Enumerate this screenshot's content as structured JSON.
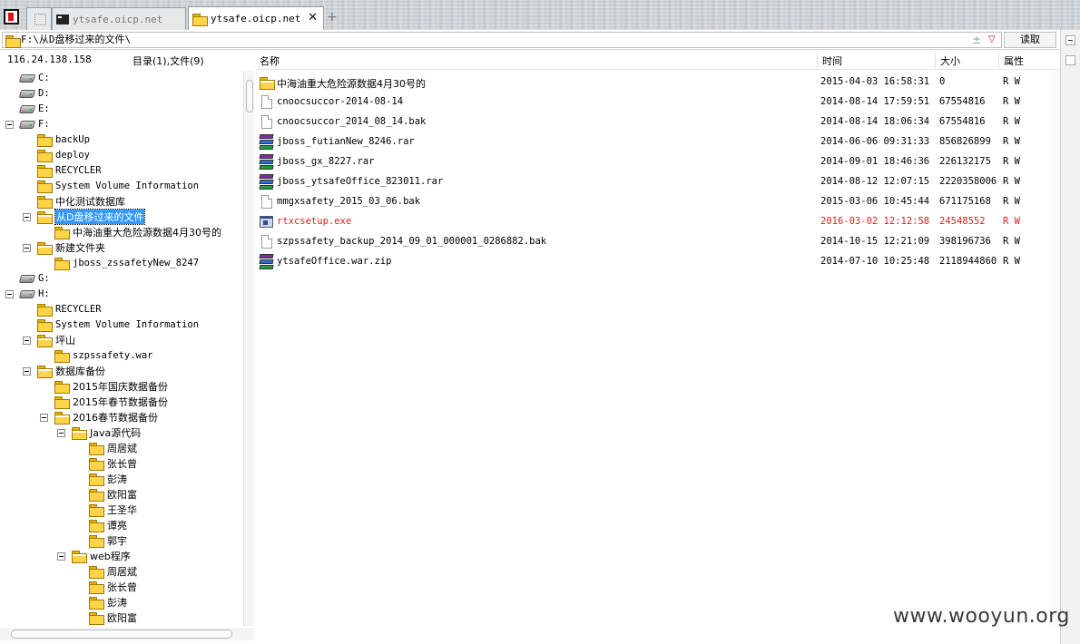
{
  "tabs": [
    {
      "label": "ytsafe.oicp.net"
    },
    {
      "label": "ytsafe.oicp.net",
      "active": true
    }
  ],
  "address": {
    "path": "F:\\从D盘移过来的文件\\",
    "read_label": "读取"
  },
  "tree_panel": {
    "ip": "116.24.138.158",
    "summary": "目录(1),文件(9)",
    "nodes": [
      {
        "label": "C:",
        "type": "drive"
      },
      {
        "label": "D:",
        "type": "drive"
      },
      {
        "label": "E:",
        "type": "drive"
      },
      {
        "label": "F:",
        "type": "drive",
        "expanded": true
      },
      {
        "label": "backUp",
        "type": "folder"
      },
      {
        "label": "deploy",
        "type": "folder"
      },
      {
        "label": "RECYCLER",
        "type": "folder"
      },
      {
        "label": "System Volume Information",
        "type": "folder"
      },
      {
        "label": "中化测试数据库",
        "type": "folder"
      },
      {
        "label": "从D盘移过来的文件",
        "type": "folder",
        "expanded": true,
        "selected": true
      },
      {
        "label": "中海油重大危险源数据4月30号的",
        "type": "folder"
      },
      {
        "label": "新建文件夹",
        "type": "folder",
        "expanded": true
      },
      {
        "label": "jboss_zssafetyNew_8247",
        "type": "folder"
      },
      {
        "label": "G:",
        "type": "drive"
      },
      {
        "label": "H:",
        "type": "drive",
        "expanded": true
      },
      {
        "label": "RECYCLER",
        "type": "folder"
      },
      {
        "label": "System Volume Information",
        "type": "folder"
      },
      {
        "label": "坪山",
        "type": "folder",
        "expanded": true
      },
      {
        "label": "szpssafety.war",
        "type": "folder"
      },
      {
        "label": "数据库备份",
        "type": "folder",
        "expanded": true
      },
      {
        "label": "2015年国庆数据备份",
        "type": "folder"
      },
      {
        "label": "2015年春节数据备份",
        "type": "folder"
      },
      {
        "label": "2016春节数据备份",
        "type": "folder",
        "expanded": true
      },
      {
        "label": "Java源代码",
        "type": "folder",
        "expanded": true
      },
      {
        "label": "周居斌",
        "type": "folder"
      },
      {
        "label": "张长曾",
        "type": "folder"
      },
      {
        "label": "彭涛",
        "type": "folder"
      },
      {
        "label": "欧阳富",
        "type": "folder"
      },
      {
        "label": "王圣华",
        "type": "folder"
      },
      {
        "label": "谭亮",
        "type": "folder"
      },
      {
        "label": "郭宇",
        "type": "folder"
      },
      {
        "label": "web程序",
        "type": "folder",
        "expanded": true
      },
      {
        "label": "周居斌",
        "type": "folder"
      },
      {
        "label": "张长曾",
        "type": "folder"
      },
      {
        "label": "彭涛",
        "type": "folder"
      },
      {
        "label": "欧阳富",
        "type": "folder"
      }
    ]
  },
  "file_list": {
    "columns": {
      "name": "名称",
      "time": "时间",
      "size": "大小",
      "attr": "属性"
    },
    "rows": [
      {
        "name": "中海油重大危险源数据4月30号的",
        "time": "2015-04-03 16:58:31",
        "size": "0",
        "attr": "R W",
        "icon": "folder-icon"
      },
      {
        "name": "cnoocsuccor-2014-08-14",
        "time": "2014-08-14 17:59:51",
        "size": "67554816",
        "attr": "R W",
        "icon": "file-icon"
      },
      {
        "name": "cnoocsuccor_2014_08_14.bak",
        "time": "2014-08-14 18:06:34",
        "size": "67554816",
        "attr": "R W",
        "icon": "file-icon"
      },
      {
        "name": "jboss_futianNew_8246.rar",
        "time": "2014-06-06 09:31:33",
        "size": "856826899",
        "attr": "R W",
        "icon": "archive-icon"
      },
      {
        "name": "jboss_gx_8227.rar",
        "time": "2014-09-01 18:46:36",
        "size": "226132175",
        "attr": "R W",
        "icon": "archive-icon"
      },
      {
        "name": "jboss_ytsafeOffice_823011.rar",
        "time": "2014-08-12 12:07:15",
        "size": "2220358006",
        "attr": "R W",
        "icon": "archive-icon"
      },
      {
        "name": "mmgxsafety_2015_03_06.bak",
        "time": "2015-03-06 10:45:44",
        "size": "671175168",
        "attr": "R W",
        "icon": "file-icon"
      },
      {
        "name": "rtxcsetup.exe",
        "time": "2016-03-02 12:12:58",
        "size": "24548552",
        "attr": "R W",
        "icon": "exe-icon",
        "highlight": true
      },
      {
        "name": "szpssafety_backup_2014_09_01_000001_0286882.bak",
        "time": "2014-10-15 12:21:09",
        "size": "398196736",
        "attr": "R W",
        "icon": "file-icon"
      },
      {
        "name": "ytsafeOffice.war.zip",
        "time": "2014-07-10 10:25:48",
        "size": "2118944860",
        "attr": "R W",
        "icon": "archive-icon"
      }
    ]
  },
  "watermark": "www.wooyun.org",
  "colors": {
    "highlight_red": "#e41b1b",
    "selection": "#3399ff",
    "folder": "#ffd447"
  }
}
